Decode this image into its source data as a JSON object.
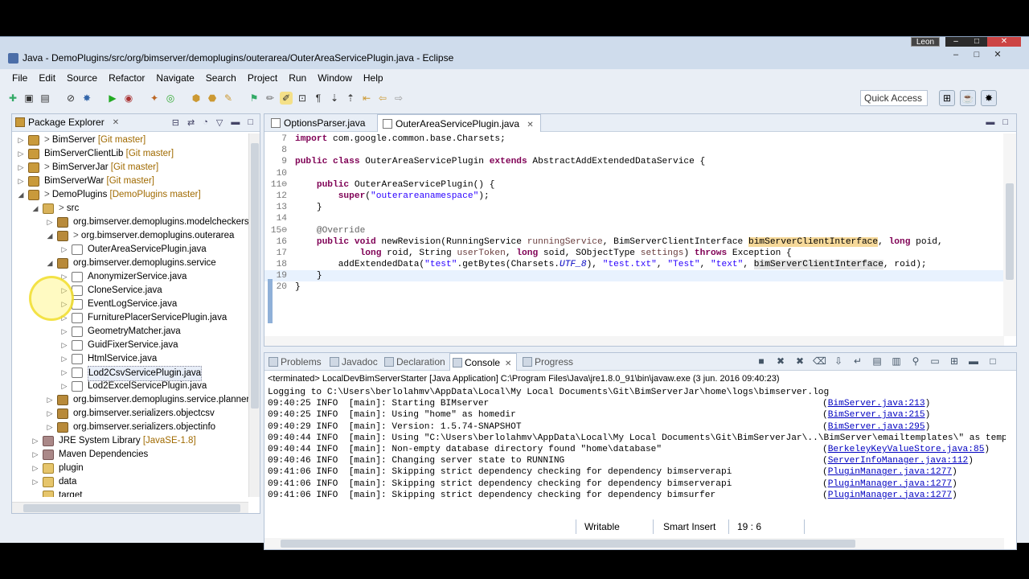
{
  "window": {
    "title": "Java - DemoPlugins/src/org/bimserver/demoplugins/outerarea/OuterAreaServicePlugin.java - Eclipse",
    "user_badge": "Leon",
    "minimize": "–",
    "maximize": "□",
    "close": "✕"
  },
  "menu": [
    "File",
    "Edit",
    "Source",
    "Refactor",
    "Navigate",
    "Search",
    "Project",
    "Run",
    "Window",
    "Help"
  ],
  "toolbar": {
    "quick_access": "Quick Access"
  },
  "package_explorer": {
    "title": "Package Explorer",
    "tree": [
      {
        "indent": 0,
        "twisty": "▷",
        "icon": "proj",
        "label": "BimServer",
        "decor": "[Git master]",
        "prefix": ">"
      },
      {
        "indent": 0,
        "twisty": "▷",
        "icon": "proj",
        "label": "BimServerClientLib",
        "decor": "[Git master]",
        "prefix": ""
      },
      {
        "indent": 0,
        "twisty": "▷",
        "icon": "proj",
        "label": "BimServerJar",
        "decor": "[Git master]",
        "prefix": ">"
      },
      {
        "indent": 0,
        "twisty": "▷",
        "icon": "proj",
        "label": "BimServerWar",
        "decor": "[Git master]",
        "prefix": ""
      },
      {
        "indent": 0,
        "twisty": "◢",
        "icon": "proj",
        "label": "DemoPlugins",
        "decor": "[DemoPlugins master]",
        "prefix": ">"
      },
      {
        "indent": 1,
        "twisty": "◢",
        "icon": "src",
        "label": "src",
        "decor": "",
        "prefix": ">"
      },
      {
        "indent": 2,
        "twisty": "▷",
        "icon": "pkg",
        "label": "org.bimserver.demoplugins.modelcheckers",
        "decor": "",
        "prefix": ""
      },
      {
        "indent": 2,
        "twisty": "◢",
        "icon": "pkg",
        "label": "org.bimserver.demoplugins.outerarea",
        "decor": "",
        "prefix": ">"
      },
      {
        "indent": 3,
        "twisty": "▷",
        "icon": "java",
        "label": "OuterAreaServicePlugin.java",
        "decor": "",
        "prefix": ""
      },
      {
        "indent": 2,
        "twisty": "◢",
        "icon": "pkg",
        "label": "org.bimserver.demoplugins.service",
        "decor": "",
        "prefix": ""
      },
      {
        "indent": 3,
        "twisty": "▷",
        "icon": "java",
        "label": "AnonymizerService.java",
        "decor": "",
        "prefix": ""
      },
      {
        "indent": 3,
        "twisty": "▷",
        "icon": "java",
        "label": "CloneService.java",
        "decor": "",
        "prefix": ""
      },
      {
        "indent": 3,
        "twisty": "▷",
        "icon": "java",
        "label": "EventLogService.java",
        "decor": "",
        "prefix": ""
      },
      {
        "indent": 3,
        "twisty": "▷",
        "icon": "java",
        "label": "FurniturePlacerServicePlugin.java",
        "decor": "",
        "prefix": ""
      },
      {
        "indent": 3,
        "twisty": "▷",
        "icon": "java",
        "label": "GeometryMatcher.java",
        "decor": "",
        "prefix": ""
      },
      {
        "indent": 3,
        "twisty": "▷",
        "icon": "java",
        "label": "GuidFixerService.java",
        "decor": "",
        "prefix": ""
      },
      {
        "indent": 3,
        "twisty": "▷",
        "icon": "java",
        "label": "HtmlService.java",
        "decor": "",
        "prefix": ""
      },
      {
        "indent": 3,
        "twisty": "▷",
        "icon": "java",
        "label": "Lod2CsvServicePlugin.java",
        "decor": "",
        "prefix": "",
        "selected": true
      },
      {
        "indent": 3,
        "twisty": "▷",
        "icon": "java",
        "label": "Lod2ExcelServicePlugin.java",
        "decor": "",
        "prefix": ""
      },
      {
        "indent": 2,
        "twisty": "▷",
        "icon": "pkg",
        "label": "org.bimserver.demoplugins.service.planner",
        "decor": "",
        "prefix": ""
      },
      {
        "indent": 2,
        "twisty": "▷",
        "icon": "pkg",
        "label": "org.bimserver.serializers.objectcsv",
        "decor": "",
        "prefix": ""
      },
      {
        "indent": 2,
        "twisty": "▷",
        "icon": "pkg",
        "label": "org.bimserver.serializers.objectinfo",
        "decor": "",
        "prefix": ""
      },
      {
        "indent": 1,
        "twisty": "▷",
        "icon": "lib",
        "label": "JRE System Library",
        "decor": "[JavaSE-1.8]",
        "prefix": ""
      },
      {
        "indent": 1,
        "twisty": "▷",
        "icon": "lib",
        "label": "Maven Dependencies",
        "decor": "",
        "prefix": ""
      },
      {
        "indent": 1,
        "twisty": "▷",
        "icon": "fold",
        "label": "plugin",
        "decor": "",
        "prefix": ""
      },
      {
        "indent": 1,
        "twisty": "▷",
        "icon": "fold",
        "label": "data",
        "decor": "",
        "prefix": ""
      },
      {
        "indent": 1,
        "twisty": "",
        "icon": "fold",
        "label": "target",
        "decor": "",
        "prefix": ""
      }
    ]
  },
  "editor": {
    "tabs": [
      {
        "label": "OptionsParser.java",
        "active": false
      },
      {
        "label": "OuterAreaServicePlugin.java",
        "active": true
      }
    ],
    "lines": [
      {
        "n": "7",
        "html": "<span class=\"kw\">import</span> com.google.common.base.Charsets;"
      },
      {
        "n": "8",
        "html": ""
      },
      {
        "n": "9",
        "html": "<span class=\"kw\">public class</span> OuterAreaServicePlugin <span class=\"kw\">extends</span> AbstractAddExtendedDataService {"
      },
      {
        "n": "10",
        "html": ""
      },
      {
        "n": "11⊖",
        "html": "    <span class=\"kw\">public</span> OuterAreaServicePlugin() {"
      },
      {
        "n": "12",
        "html": "        <span class=\"kw\">super</span>(<span class=\"str\">\"outerareanamespace\"</span>);"
      },
      {
        "n": "13",
        "html": "    }"
      },
      {
        "n": "14",
        "html": ""
      },
      {
        "n": "15⊖",
        "html": "    <span class=\"ann\">@Override</span>"
      },
      {
        "n": "16",
        "html": "    <span class=\"kw\">public void</span> newRevision(RunningService <span style=\"color:#6a3e3e\">runningService</span>, BimServerClientInterface <span class=\"hl\">bimServerClientInterface</span>, <span class=\"kw\">long</span> poid,"
      },
      {
        "n": "17",
        "html": "            <span class=\"kw\">long</span> roid, String <span style=\"color:#6a3e3e\">userToken</span>, <span class=\"kw\">long</span> soid, SObjectType <span style=\"color:#6a3e3e\">settings</span>) <span class=\"kw\">throws</span> Exception {"
      },
      {
        "n": "18",
        "html": "        addExtendedData(<span class=\"str\">\"test\"</span>.getBytes(Charsets.<span class=\"fld\">UTF_8</span>), <span class=\"str\">\"test.txt\"</span>, <span class=\"str\">\"Test\"</span>, <span class=\"str\">\"text\"</span>, <span class=\"hl2\">bimServerClientInterface</span>, roid);"
      },
      {
        "n": "19",
        "html": "    }",
        "current": true
      },
      {
        "n": "20",
        "html": "}"
      }
    ]
  },
  "console": {
    "tabs": [
      "Problems",
      "Javadoc",
      "Declaration",
      "Console",
      "Progress"
    ],
    "active_tab": "Console",
    "terminated": "<terminated> LocalDevBimServerStarter [Java Application] C:\\Program Files\\Java\\jre1.8.0_91\\bin\\javaw.exe (3 jun. 2016 09:40:23)",
    "lines": [
      {
        "text": "Logging to C:\\Users\\berlolahmv\\AppData\\Local\\My Local Documents\\Git\\BimServerJar\\home\\logs\\bimserver.log",
        "link": ""
      },
      {
        "text": "09:40:25 INFO  [main]: Starting BIMserver",
        "link": "BimServer.java:213"
      },
      {
        "text": "09:40:25 INFO  [main]: Using \"home\" as homedir",
        "link": "BimServer.java:215"
      },
      {
        "text": "09:40:29 INFO  [main]: Version: 1.5.74-SNAPSHOT",
        "link": "BimServer.java:295"
      },
      {
        "text": "09:40:44 INFO  [main]: Using \"C:\\Users\\berlolahmv\\AppData\\Local\\My Local Documents\\Git\\BimServerJar\\..\\BimServer\\emailtemplates\\\" as templa",
        "link": ""
      },
      {
        "text": "09:40:44 INFO  [main]: Non-empty database directory found \"home\\database\"",
        "link": "BerkeleyKeyValueStore.java:85"
      },
      {
        "text": "09:40:46 INFO  [main]: Changing server state to RUNNING",
        "link": "ServerInfoManager.java:112"
      },
      {
        "text": "09:41:06 INFO  [main]: Skipping strict dependency checking for dependency bimserverapi",
        "link": "PluginManager.java:1277"
      },
      {
        "text": "09:41:06 INFO  [main]: Skipping strict dependency checking for dependency bimserverapi",
        "link": "PluginManager.java:1277"
      },
      {
        "text": "09:41:06 INFO  [main]: Skipping strict dependency checking for dependency bimsurfer",
        "link": "PluginManager.java:1277"
      }
    ]
  },
  "status": {
    "writable": "Writable",
    "insert_mode": "Smart Insert",
    "position": "19 : 6"
  }
}
